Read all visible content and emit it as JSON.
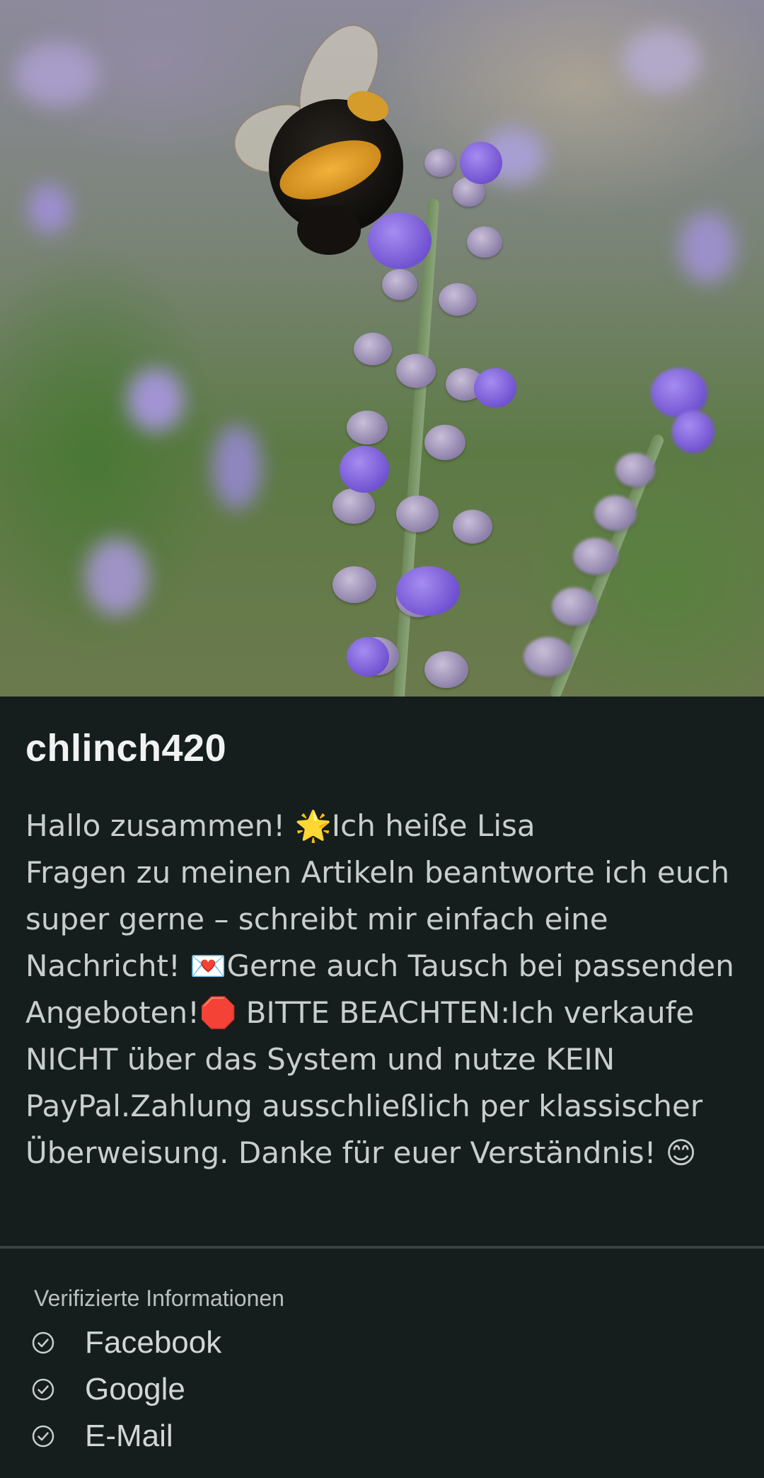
{
  "cover_photo": {
    "icon": "bee-on-lavender-photo"
  },
  "profile": {
    "username": "chlinch420",
    "bio": "Hallo zusammen! 🌟Ich heiße Lisa\nFragen zu meinen Artikeln beantworte ich euch super gerne – schreibt mir einfach eine Nachricht! 💌Gerne auch Tausch bei passenden Angeboten!🛑 BITTE BEACHTEN:Ich verkaufe NICHT über das System und nutze KEIN PayPal.Zahlung ausschließlich per klassischer Überweisung. Danke für euer Verständnis! 😊"
  },
  "verified": {
    "title": "Verifizierte Informationen",
    "items": [
      {
        "label": "Facebook",
        "icon": "check-circle-icon"
      },
      {
        "label": "Google",
        "icon": "check-circle-icon"
      },
      {
        "label": "E-Mail",
        "icon": "check-circle-icon"
      }
    ]
  },
  "colors": {
    "background": "#161d1d",
    "username": "#f1f3f2",
    "bio_text": "#c9cecd",
    "divider": "#3a4242"
  }
}
